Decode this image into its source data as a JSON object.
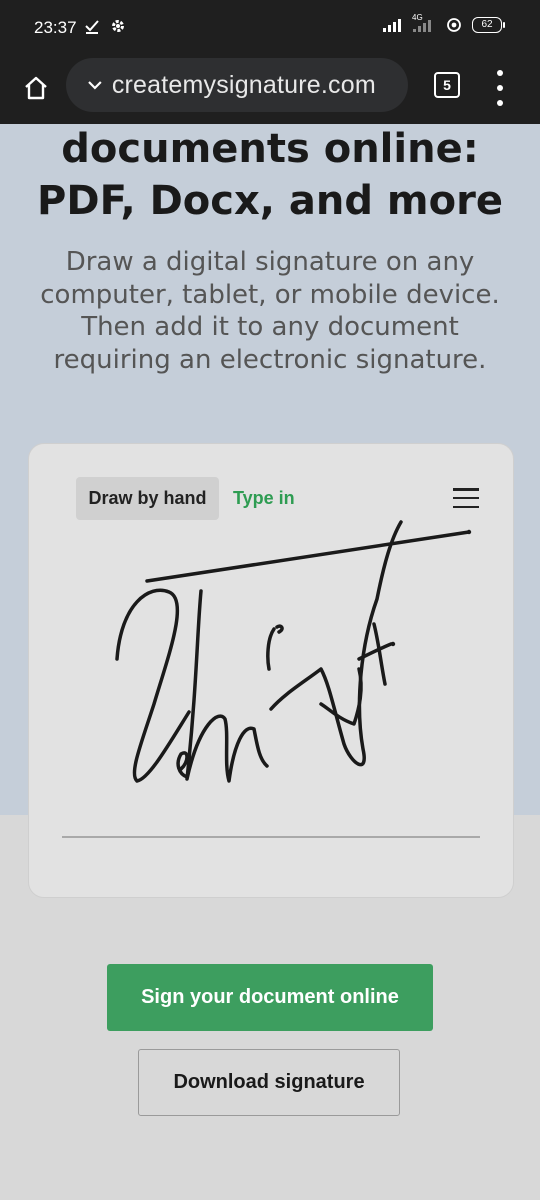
{
  "status_bar": {
    "time": "23:37",
    "network_label": "4G",
    "battery": "62",
    "icons": [
      "check-icon",
      "gear-icon",
      "signal-icon",
      "signal-4g-icon",
      "hotspot-icon",
      "battery-icon"
    ]
  },
  "browser": {
    "url": "createmysignature.com",
    "tab_count": "5",
    "icons": [
      "home-icon",
      "chevron-down-icon",
      "tabs-icon",
      "more-vert-icon"
    ]
  },
  "hero": {
    "headline_lines": [
      "documents online:",
      "PDF, Docx, and more"
    ],
    "subtext_lines": [
      "Draw a digital signature on any",
      "computer, tablet, or mobile device.",
      "Then add it to any document",
      "requiring an electronic signature."
    ]
  },
  "signature_pad": {
    "tabs": {
      "draw": "Draw by hand",
      "type": "Type in"
    },
    "menu_icon": "hamburger-menu-icon"
  },
  "actions": {
    "sign_online": "Sign your document online",
    "download": "Download signature"
  },
  "colors": {
    "browser_bar": "#1f1f1f",
    "hero_background": "#c5ced9",
    "accent_green": "#3d9e5f",
    "tab_green": "#2e9c52"
  }
}
